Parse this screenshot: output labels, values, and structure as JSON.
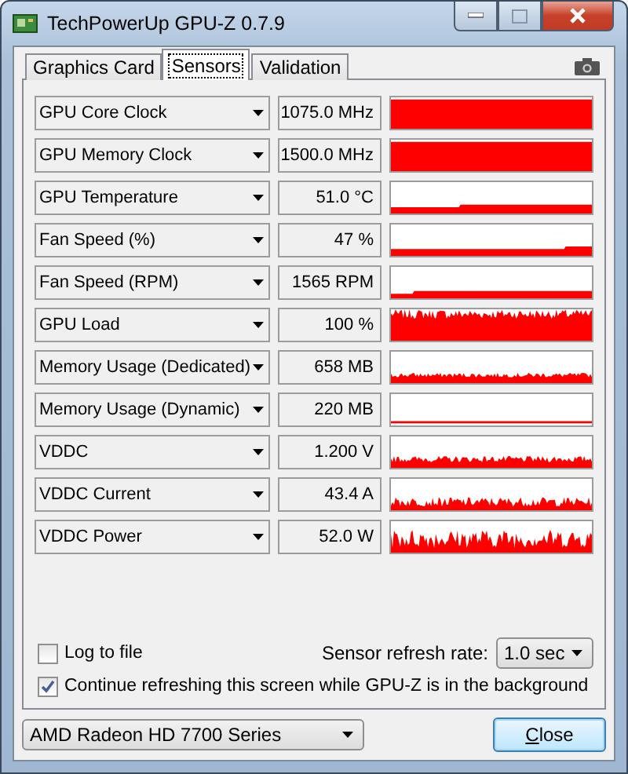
{
  "window": {
    "title": "TechPowerUp GPU-Z 0.7.9"
  },
  "tabs": [
    {
      "label": "Graphics Card",
      "selected": false
    },
    {
      "label": "Sensors",
      "selected": true
    },
    {
      "label": "Validation",
      "selected": false
    }
  ],
  "sensors": [
    {
      "name": "GPU Core Clock",
      "value": "1075.0 MHz"
    },
    {
      "name": "GPU Memory Clock",
      "value": "1500.0 MHz"
    },
    {
      "name": "GPU Temperature",
      "value": "51.0 °C"
    },
    {
      "name": "Fan Speed (%)",
      "value": "47 %"
    },
    {
      "name": "Fan Speed (RPM)",
      "value": "1565 RPM"
    },
    {
      "name": "GPU Load",
      "value": "100 %"
    },
    {
      "name": "Memory Usage (Dedicated)",
      "value": "658 MB"
    },
    {
      "name": "Memory Usage (Dynamic)",
      "value": "220 MB"
    },
    {
      "name": "VDDC",
      "value": "1.200 V"
    },
    {
      "name": "VDDC Current",
      "value": "43.4 A"
    },
    {
      "name": "VDDC Power",
      "value": "52.0 W"
    }
  ],
  "refresh": {
    "label": "Sensor refresh rate:",
    "value": "1.0 sec"
  },
  "options": [
    {
      "label": "Log to file",
      "checked": false
    },
    {
      "label": "Continue refreshing this screen while GPU-Z is in the background",
      "checked": true
    }
  ],
  "gpu_select": {
    "value": "AMD Radeon HD 7700 Series"
  },
  "close_button": "Close"
}
